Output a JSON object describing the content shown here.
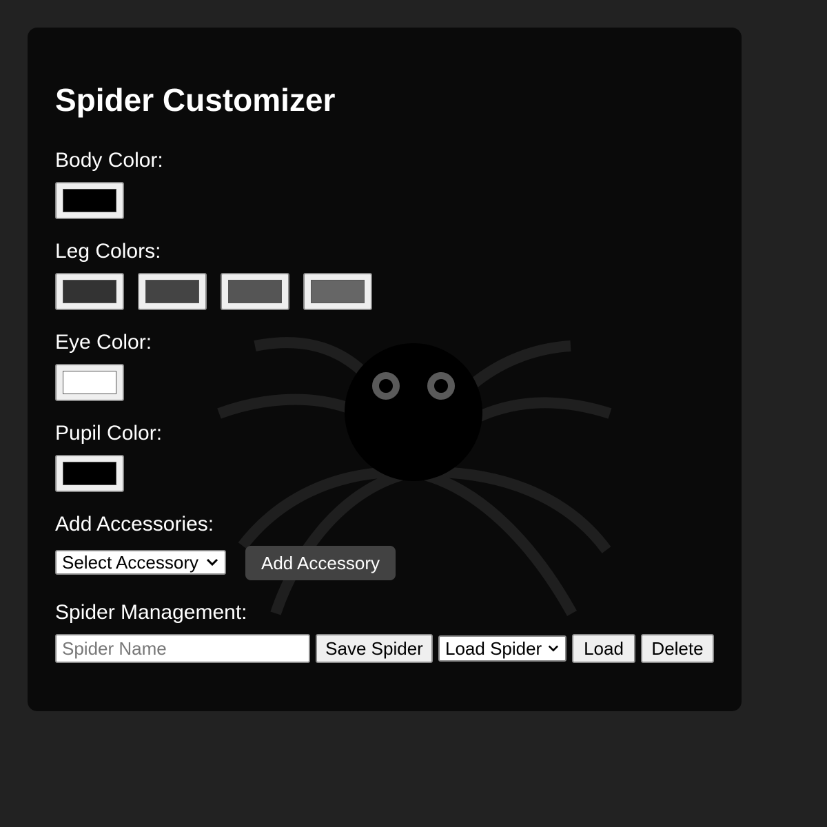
{
  "app": {
    "title": "Spider Customizer"
  },
  "body_color": {
    "label": "Body Color:",
    "value": "#000000"
  },
  "leg_colors": {
    "label": "Leg Colors:",
    "values": [
      "#333333",
      "#444444",
      "#555555",
      "#666666"
    ]
  },
  "eye_color": {
    "label": "Eye Color:",
    "value": "#ffffff"
  },
  "pupil_color": {
    "label": "Pupil Color:",
    "value": "#000000"
  },
  "accessories": {
    "label": "Add Accessories:",
    "select_value": "Select Accessory",
    "add_button": "Add Accessory"
  },
  "management": {
    "label": "Spider Management:",
    "name_placeholder": "Spider Name",
    "name_value": "",
    "save_button": "Save Spider",
    "load_select_value": "Load Spider",
    "load_button": "Load",
    "delete_button": "Delete"
  },
  "preview": {
    "body_color": "#000000",
    "leg_color": "#1f1f1f",
    "eye_ring_color": "#5a5a5a"
  }
}
